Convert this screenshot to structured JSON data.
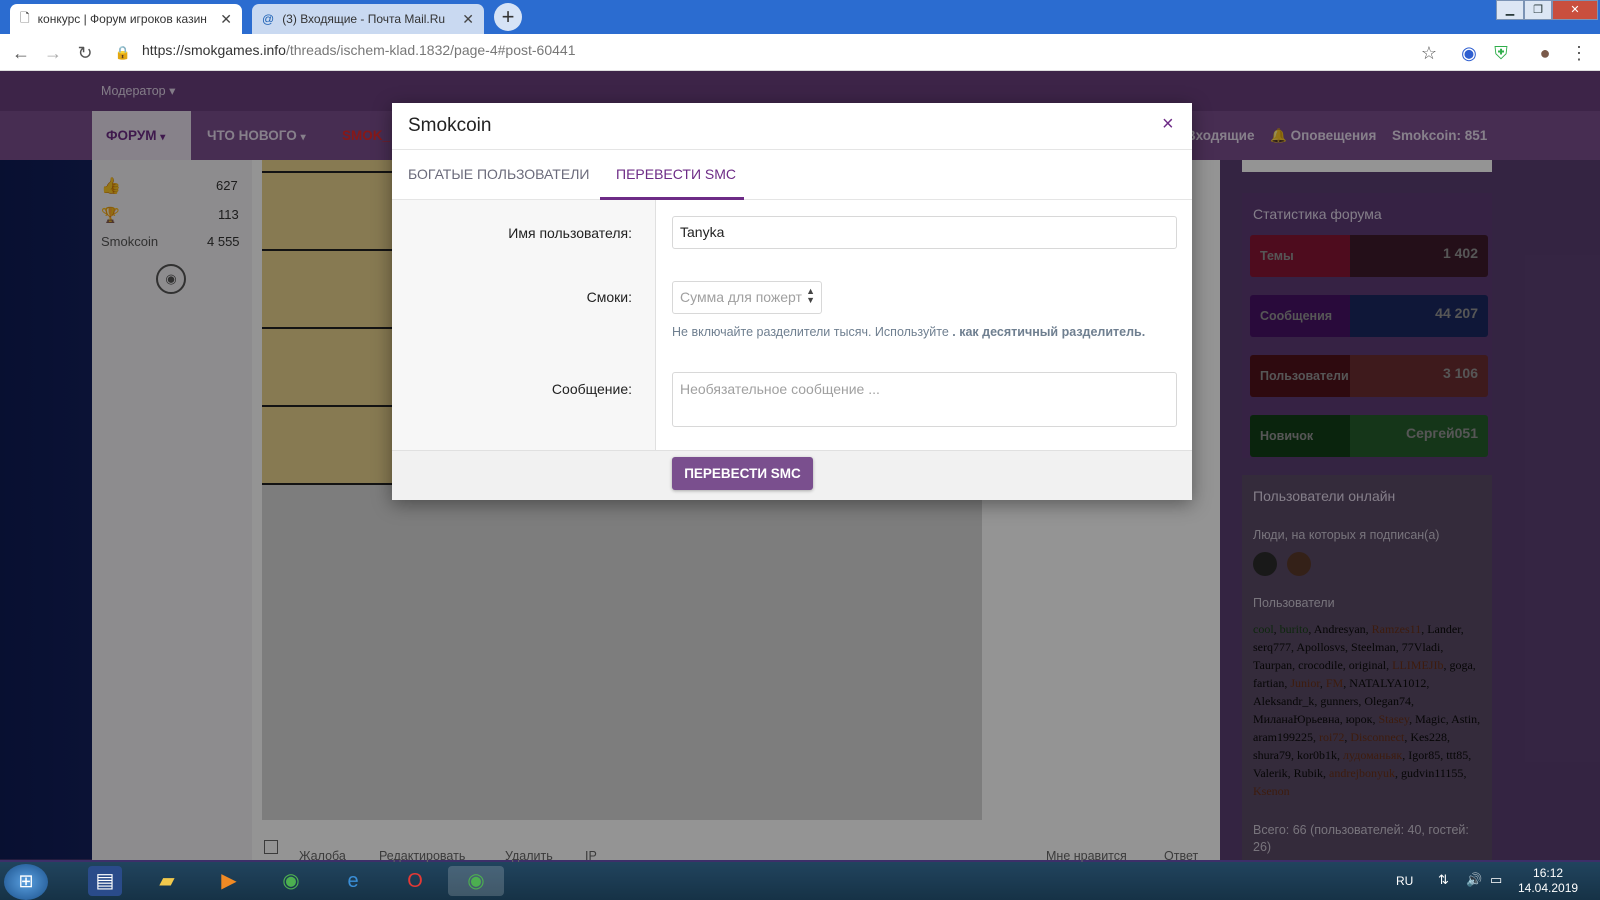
{
  "browser": {
    "tabs": [
      {
        "title": "конкурс | Форум игроков казин",
        "active": true
      },
      {
        "title": "(3) Входящие - Почта Mail.Ru",
        "active": false
      }
    ],
    "new_tab": "+",
    "url_host": "https://smokgames.info",
    "url_path": "/threads/ischem-klad.1832/page-4#post-60441"
  },
  "site": {
    "moderator": "Модератор ▾",
    "nav": [
      "ФОРУМ",
      "ЧТО НОВОГО",
      "SMOK_"
    ],
    "nav_right": [
      "Входящие",
      "Оповещения",
      "Smokcoin: 851"
    ]
  },
  "left_stats": [
    {
      "value": "627"
    },
    {
      "value": "113"
    },
    {
      "label": "Smokcoin",
      "value": "4 555"
    }
  ],
  "post_actions": [
    "Жалоба",
    "Редактировать",
    "Удалить",
    "IP",
    "Мне нравится",
    "Ответ"
  ],
  "modal": {
    "title": "Smokcoin",
    "close": "×",
    "tabs": [
      "БОГАТЫЕ ПОЛЬЗОВАТЕЛИ",
      "ПЕРЕВЕСТИ SMC"
    ],
    "active_tab": 1,
    "username_label": "Имя пользователя:",
    "username_value": "Tanyka",
    "amount_label": "Смоки:",
    "amount_placeholder": "Сумма для пожерт",
    "amount_hint_a": "Не включайте разделители тысяч. Используйте",
    "amount_hint_b": ". как десятичный разделитель.",
    "message_label": "Сообщение:",
    "message_placeholder": "Необязательное сообщение ...",
    "submit": "ПЕРЕВЕСТИ SMC"
  },
  "forum_stats": {
    "title": "Статистика форума",
    "rows": [
      {
        "label": "Темы",
        "value": "1 402",
        "color_label": "#e8245a",
        "color_value": "#6b2e4a"
      },
      {
        "label": "Сообщения",
        "value": "44 207",
        "color_label": "#7a1fb0",
        "color_value": "#2e47a8"
      },
      {
        "label": "Пользователи",
        "value": "3 106",
        "color_label": "#8a1f2f",
        "color_value": "#b84d55"
      },
      {
        "label": "Новичок",
        "value": "Сергей051",
        "color_label": "#1f6b2a",
        "color_value": "#3fa14c"
      }
    ]
  },
  "online": {
    "title": "Пользователи онлайн",
    "following": "Люди, на которых я подписан(а)",
    "users_heading": "Пользователи",
    "users": [
      {
        "name": "cool",
        "color": "#2b7a2b"
      },
      {
        "name": "burito",
        "color": "#2b7a2b"
      },
      {
        "name": "Andresyan",
        "color": "#111"
      },
      {
        "name": "Ramzes11",
        "color": "#c0582a"
      },
      {
        "name": "Lander",
        "color": "#111"
      },
      {
        "name": "serq777",
        "color": "#111"
      },
      {
        "name": "Apollosvs",
        "color": "#111"
      },
      {
        "name": "Steelman",
        "color": "#111"
      },
      {
        "name": "77Vladi",
        "color": "#111"
      },
      {
        "name": "Taurpan",
        "color": "#111"
      },
      {
        "name": "crocodile",
        "color": "#111"
      },
      {
        "name": "original",
        "color": "#111"
      },
      {
        "name": "LLIMEJIb",
        "color": "#c0582a"
      },
      {
        "name": "goga",
        "color": "#111"
      },
      {
        "name": "fartian",
        "color": "#111"
      },
      {
        "name": "Junior",
        "color": "#c0582a"
      },
      {
        "name": "FM",
        "color": "#c0582a"
      },
      {
        "name": "NATALYA1012",
        "color": "#111"
      },
      {
        "name": "Aleksandr_k",
        "color": "#111"
      },
      {
        "name": "gunners",
        "color": "#111"
      },
      {
        "name": "Olegan74",
        "color": "#111"
      },
      {
        "name": "МиланаЮрьевна",
        "color": "#111"
      },
      {
        "name": "юрок",
        "color": "#111"
      },
      {
        "name": "Stasey",
        "color": "#c0582a"
      },
      {
        "name": "Magic",
        "color": "#111"
      },
      {
        "name": "Astin",
        "color": "#111"
      },
      {
        "name": "aram199225",
        "color": "#111"
      },
      {
        "name": "roi72",
        "color": "#c0582a"
      },
      {
        "name": "Disconnect",
        "color": "#c0582a"
      },
      {
        "name": "Kes228",
        "color": "#111"
      },
      {
        "name": "shura79",
        "color": "#111"
      },
      {
        "name": "kor0b1k",
        "color": "#111"
      },
      {
        "name": "лудоманьяк",
        "color": "#c0582a"
      },
      {
        "name": "Igor85",
        "color": "#111"
      },
      {
        "name": "ttt85",
        "color": "#111"
      },
      {
        "name": "Valerik",
        "color": "#111"
      },
      {
        "name": "Rubik",
        "color": "#111"
      },
      {
        "name": "andrejbonyuk",
        "color": "#c0582a"
      },
      {
        "name": "gudvin11155",
        "color": "#111"
      },
      {
        "name": "Ksenon",
        "color": "#c0582a"
      }
    ],
    "total": "Всего: 66 (пользователей: 40, гостей: 26)"
  },
  "taskbar": {
    "lang": "RU",
    "time": "16:12",
    "date": "14.04.2019"
  }
}
